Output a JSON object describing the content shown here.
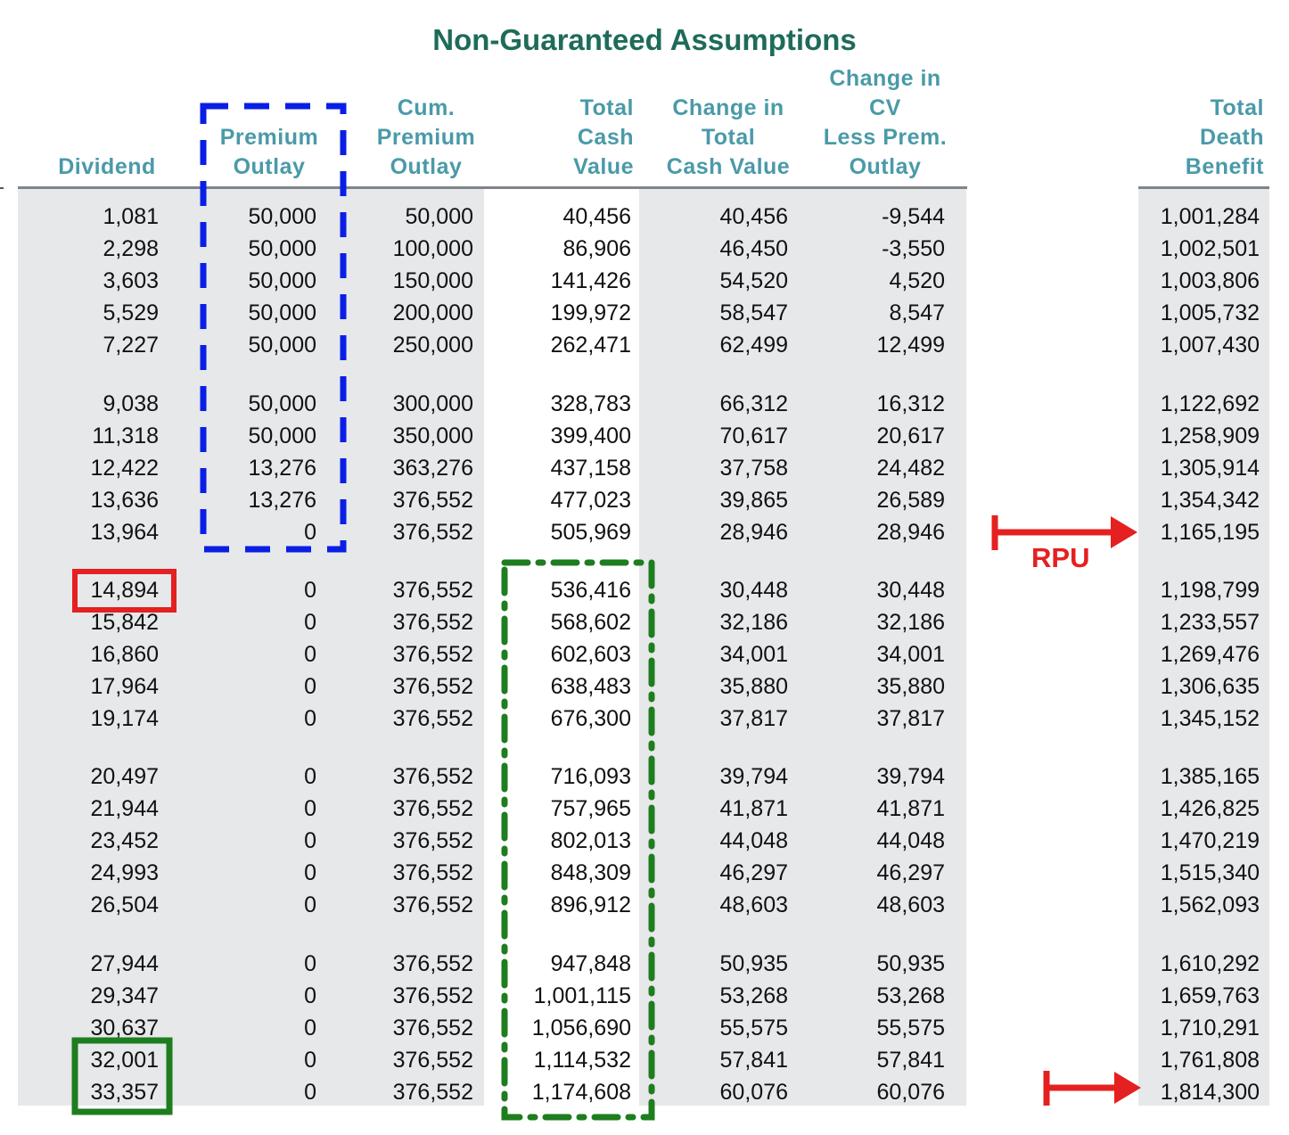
{
  "title": "Non-Guaranteed Assumptions",
  "headers": {
    "dividend": [
      "Dividend"
    ],
    "premium_outlay": [
      "Premium",
      "Outlay"
    ],
    "cum_premium_outlay": [
      "Cum.",
      "Premium",
      "Outlay"
    ],
    "total_cash_value": [
      "Total",
      "Cash",
      "Value"
    ],
    "change_total_cash_value": [
      "Change in",
      "Total",
      "Cash Value"
    ],
    "change_cv_less_prem": [
      "Change in",
      "CV",
      "Less Prem.",
      "Outlay"
    ],
    "total_death_benefit": [
      "Total",
      "Death",
      "Benefit"
    ]
  },
  "rows": [
    [
      "1,081",
      "50,000",
      "50,000",
      "40,456",
      "40,456",
      "-9,544",
      "1,001,284"
    ],
    [
      "2,298",
      "50,000",
      "100,000",
      "86,906",
      "46,450",
      "-3,550",
      "1,002,501"
    ],
    [
      "3,603",
      "50,000",
      "150,000",
      "141,426",
      "54,520",
      "4,520",
      "1,003,806"
    ],
    [
      "5,529",
      "50,000",
      "200,000",
      "199,972",
      "58,547",
      "8,547",
      "1,005,732"
    ],
    [
      "7,227",
      "50,000",
      "250,000",
      "262,471",
      "62,499",
      "12,499",
      "1,007,430"
    ],
    [
      "9,038",
      "50,000",
      "300,000",
      "328,783",
      "66,312",
      "16,312",
      "1,122,692"
    ],
    [
      "11,318",
      "50,000",
      "350,000",
      "399,400",
      "70,617",
      "20,617",
      "1,258,909"
    ],
    [
      "12,422",
      "13,276",
      "363,276",
      "437,158",
      "37,758",
      "24,482",
      "1,305,914"
    ],
    [
      "13,636",
      "13,276",
      "376,552",
      "477,023",
      "39,865",
      "26,589",
      "1,354,342"
    ],
    [
      "13,964",
      "0",
      "376,552",
      "505,969",
      "28,946",
      "28,946",
      "1,165,195"
    ],
    [
      "14,894",
      "0",
      "376,552",
      "536,416",
      "30,448",
      "30,448",
      "1,198,799"
    ],
    [
      "15,842",
      "0",
      "376,552",
      "568,602",
      "32,186",
      "32,186",
      "1,233,557"
    ],
    [
      "16,860",
      "0",
      "376,552",
      "602,603",
      "34,001",
      "34,001",
      "1,269,476"
    ],
    [
      "17,964",
      "0",
      "376,552",
      "638,483",
      "35,880",
      "35,880",
      "1,306,635"
    ],
    [
      "19,174",
      "0",
      "376,552",
      "676,300",
      "37,817",
      "37,817",
      "1,345,152"
    ],
    [
      "20,497",
      "0",
      "376,552",
      "716,093",
      "39,794",
      "39,794",
      "1,385,165"
    ],
    [
      "21,944",
      "0",
      "376,552",
      "757,965",
      "41,871",
      "41,871",
      "1,426,825"
    ],
    [
      "23,452",
      "0",
      "376,552",
      "802,013",
      "44,048",
      "44,048",
      "1,470,219"
    ],
    [
      "24,993",
      "0",
      "376,552",
      "848,309",
      "46,297",
      "46,297",
      "1,515,340"
    ],
    [
      "26,504",
      "0",
      "376,552",
      "896,912",
      "48,603",
      "48,603",
      "1,562,093"
    ],
    [
      "27,944",
      "0",
      "376,552",
      "947,848",
      "50,935",
      "50,935",
      "1,610,292"
    ],
    [
      "29,347",
      "0",
      "376,552",
      "1,001,115",
      "53,268",
      "53,268",
      "1,659,763"
    ],
    [
      "30,637",
      "0",
      "376,552",
      "1,056,690",
      "55,575",
      "55,575",
      "1,710,291"
    ],
    [
      "32,001",
      "0",
      "376,552",
      "1,114,532",
      "57,841",
      "57,841",
      "1,761,808"
    ],
    [
      "33,357",
      "0",
      "376,552",
      "1,174,608",
      "60,076",
      "60,076",
      "1,814,300"
    ]
  ],
  "annotations": {
    "rpu_label": "RPU",
    "colors": {
      "blue": "#0a1ee6",
      "green": "#1e7d1e",
      "red": "#e52020"
    }
  }
}
